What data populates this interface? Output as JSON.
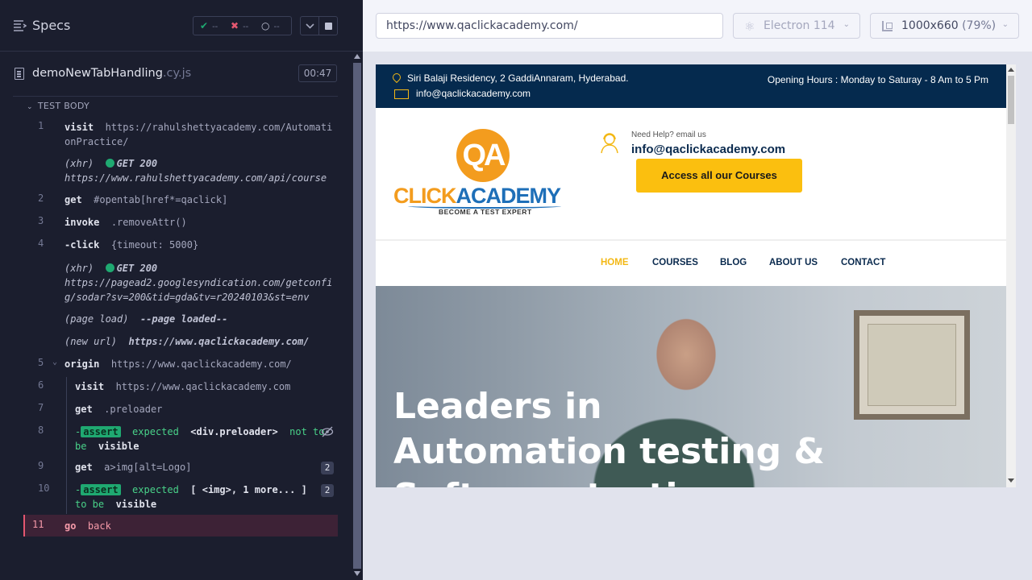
{
  "reporter": {
    "title": "Specs",
    "stats": {
      "passed": "--",
      "failed": "--",
      "pending": "--"
    },
    "spec_name": "demoNewTabHandling",
    "spec_ext": ".cy.js",
    "duration": "00:47",
    "section_label": "TEST BODY",
    "commands": [
      {
        "num": "1",
        "name": "visit",
        "msg_line1": "https://rahulshettyacademy.com/Automati",
        "msg_line2": "onPractice/"
      },
      {
        "label": "(xhr)",
        "status": "GET 200",
        "url": "https://www.rahulshettyacademy.com/api/course"
      },
      {
        "num": "2",
        "name": "get",
        "msg": "#opentab[href*=qaclick]"
      },
      {
        "num": "3",
        "name": "invoke",
        "msg": ".removeAttr()"
      },
      {
        "num": "4",
        "name": "-click",
        "msg": "{timeout: 5000}"
      },
      {
        "label": "(xhr)",
        "status": "GET 200",
        "url_line1": "https://pagead2.googlesyndication.com/getconfi",
        "url_line2": "g/sodar?sv=200&tid=gda&tv=r20240103&st=env"
      },
      {
        "label": "(page load)",
        "msg": "--page loaded--"
      },
      {
        "label": "(new url)",
        "msg": "https://www.qaclickacademy.com/"
      },
      {
        "num": "5",
        "name": "origin",
        "msg": "https://www.qaclickacademy.com/"
      },
      {
        "num": "6",
        "name": "visit",
        "msg": "https://www.qaclickacademy.com"
      },
      {
        "num": "7",
        "name": "get",
        "msg": ".preloader"
      },
      {
        "num": "8",
        "badge": "assert",
        "text_line1": "expected",
        "el": "<div.preloader>",
        "rest": "not to",
        "text_line2": "be",
        "text_line2b": "visible"
      },
      {
        "num": "9",
        "name": "get",
        "msg": "a>img[alt=Logo]",
        "count": "2"
      },
      {
        "num": "10",
        "badge": "assert",
        "text_line1": "expected",
        "el": "[ <img>, 1 more... ]",
        "text_line2": "to be",
        "text_line2b": "visible",
        "count": "2"
      },
      {
        "num": "11",
        "name": "go",
        "msg": "back"
      }
    ]
  },
  "browser": {
    "url": "https://www.qaclickacademy.com/",
    "engine": "Electron 114",
    "viewport": "1000x660",
    "zoom": "(79%)"
  },
  "site": {
    "address": "Siri Balaji Residency, 2 GaddiAnnaram, Hyderabad.",
    "email": "info@qaclickacademy.com",
    "hours": "Opening Hours : Monday to Saturay - 8 Am to 5 Pm",
    "logo_qa": "QA",
    "logo_word1": "CLICK",
    "logo_word2": "ACADEMY",
    "tagline": "BECOME A TEST EXPERT",
    "need_help": "Need Help? email us",
    "help_email": "info@qaclickacademy.com",
    "cta": "Access all our Courses",
    "nav": [
      "HOME",
      "COURSES",
      "BLOG",
      "ABOUT US",
      "CONTACT"
    ],
    "hero_line1": "Leaders in",
    "hero_line2": "Automation testing &",
    "hero_line3": "Software testing"
  },
  "colors": {
    "pass": "#1fa971",
    "fail": "#e45770",
    "accent": "#fbbf0f",
    "navy": "#052a4e"
  }
}
